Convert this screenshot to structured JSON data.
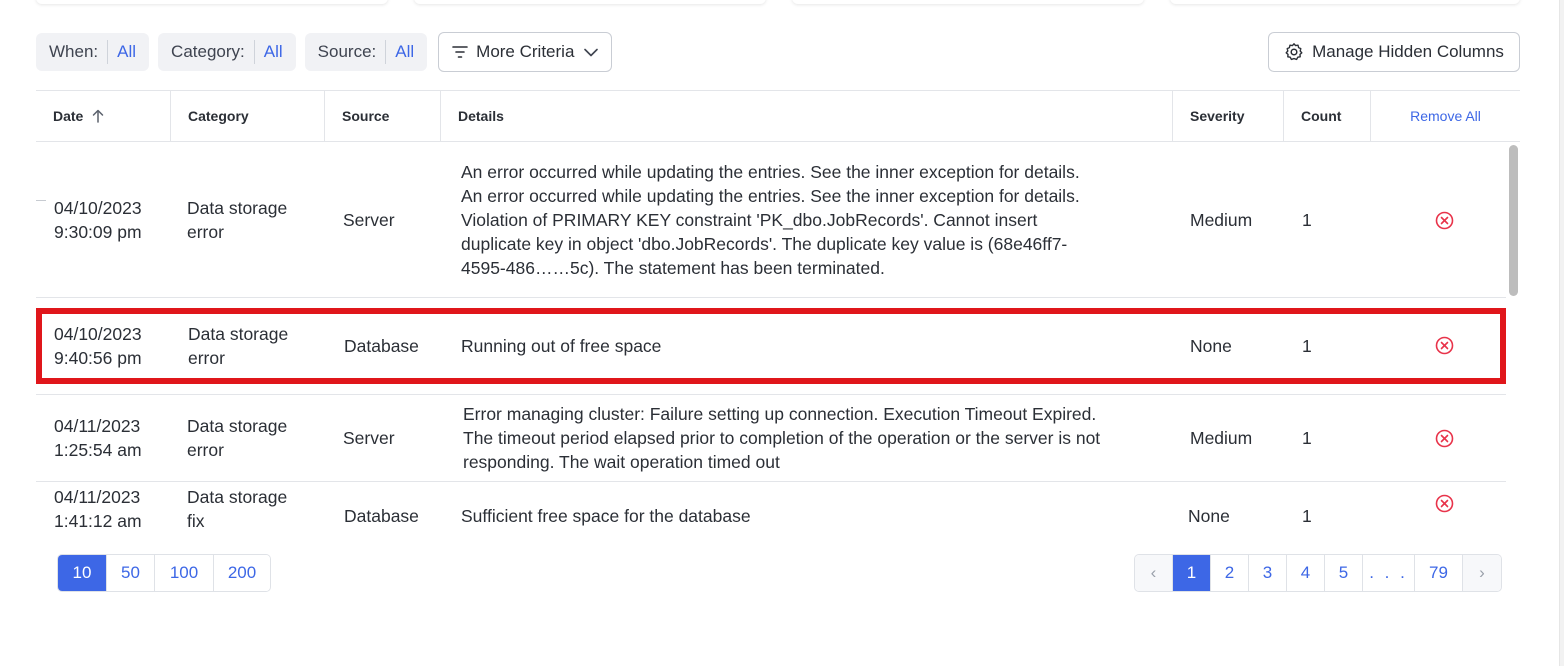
{
  "filters": [
    {
      "label": "When:",
      "value": "All"
    },
    {
      "label": "Category:",
      "value": "All"
    },
    {
      "label": "Source:",
      "value": "All"
    }
  ],
  "more_criteria": {
    "label": "More Criteria",
    "icon": "filter-lines-icon",
    "chevron": "chevron-down-icon"
  },
  "manage_columns": {
    "label": "Manage Hidden Columns",
    "icon": "gear-icon"
  },
  "table": {
    "headers": {
      "date": "Date",
      "category": "Category",
      "source": "Source",
      "details": "Details",
      "severity": "Severity",
      "count": "Count",
      "remove_all": "Remove All"
    },
    "sort": {
      "column": "date",
      "direction": "ascending",
      "icon": "arrow-up-icon"
    },
    "rows": [
      {
        "date": "04/10/2023",
        "time": "9:30:09 pm",
        "category_1": "Data storage",
        "category_2": "error",
        "source": "Server",
        "details": "An error occurred while updating the entries. See the inner exception for details. An error occurred while updating the entries. See the inner exception for details. Violation of PRIMARY KEY constraint 'PK_dbo.JobRecords'. Cannot insert duplicate key in object 'dbo.JobRecords'. The duplicate key value is (68e46ff7-4595-486……5c). The statement has been terminated.",
        "severity": "Medium",
        "count": "1"
      },
      {
        "date": "04/10/2023",
        "time": "9:40:56 pm",
        "category_1": "Data storage",
        "category_2": "error",
        "source": "Database",
        "details": "Running out of free space",
        "severity": "None",
        "count": "1",
        "highlighted": true
      },
      {
        "date": "04/11/2023",
        "time": "1:25:54 am",
        "category_1": "Data storage",
        "category_2": "error",
        "source": "Server",
        "details": "Error managing cluster: Failure setting up connection. Execution Timeout Expired. The timeout period elapsed prior to completion of the operation or the server is not responding. The wait operation timed out",
        "severity": "Medium",
        "count": "1"
      },
      {
        "date": "04/11/2023",
        "time": "1:41:12 am",
        "category_1": "Data storage",
        "category_2": "fix",
        "source": "Database",
        "details": "Sufficient free space for the database",
        "severity": "None",
        "count": "1"
      }
    ],
    "remove_icon": "remove-circle-x-icon"
  },
  "page_sizes": [
    "10",
    "50",
    "100",
    "200"
  ],
  "page_size_selected": "10",
  "pagination": {
    "prev": "‹",
    "pages": [
      "1",
      "2",
      "3",
      "4",
      "5"
    ],
    "ellipsis": ". . .",
    "last": "79",
    "next": "›",
    "current": "1"
  },
  "colors": {
    "accent": "#3d67e6",
    "highlight_border": "#e0161b",
    "remove_icon": "#e8334a"
  }
}
